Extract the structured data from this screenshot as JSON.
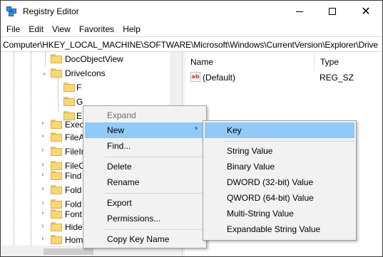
{
  "window": {
    "title": "Registry Editor"
  },
  "menubar": [
    "File",
    "Edit",
    "View",
    "Favorites",
    "Help"
  ],
  "address": "Computer\\HKEY_LOCAL_MACHINE\\SOFTWARE\\Microsoft\\Windows\\CurrentVersion\\Explorer\\Drive",
  "tree": {
    "items": [
      {
        "label": "DocObjectView"
      },
      {
        "label": "DriveIcons"
      },
      {
        "label": "F"
      },
      {
        "label": "G"
      },
      {
        "label": "E"
      },
      {
        "label": "Exec"
      },
      {
        "label": "FileA"
      },
      {
        "label": "FileIn"
      },
      {
        "label": "FileO"
      },
      {
        "label": "Find"
      },
      {
        "label": "Fold"
      },
      {
        "label": "Fold"
      },
      {
        "label": "Font"
      },
      {
        "label": "Hide"
      },
      {
        "label": "Hom"
      }
    ]
  },
  "list": {
    "headers": {
      "name": "Name",
      "type": "Type"
    },
    "rows": [
      {
        "name": "(Default)",
        "type": "REG_SZ",
        "icon": "ab"
      }
    ]
  },
  "context_menu": {
    "items": [
      {
        "label": "Expand"
      },
      {
        "label": "New",
        "arrow": "›"
      },
      {
        "label": "Find..."
      },
      {
        "label": "Delete"
      },
      {
        "label": "Rename"
      },
      {
        "label": "Export"
      },
      {
        "label": "Permissions..."
      },
      {
        "label": "Copy Key Name"
      }
    ]
  },
  "submenu": {
    "items": [
      {
        "label": "Key"
      },
      {
        "label": "String Value"
      },
      {
        "label": "Binary Value"
      },
      {
        "label": "DWORD (32-bit) Value"
      },
      {
        "label": "QWORD (64-bit) Value"
      },
      {
        "label": "Multi-String Value"
      },
      {
        "label": "Expandable String Value"
      }
    ]
  },
  "colors": {
    "highlight": "#91c9f7",
    "folder": "#f8d775",
    "menu_bg": "#f2f2f2"
  }
}
